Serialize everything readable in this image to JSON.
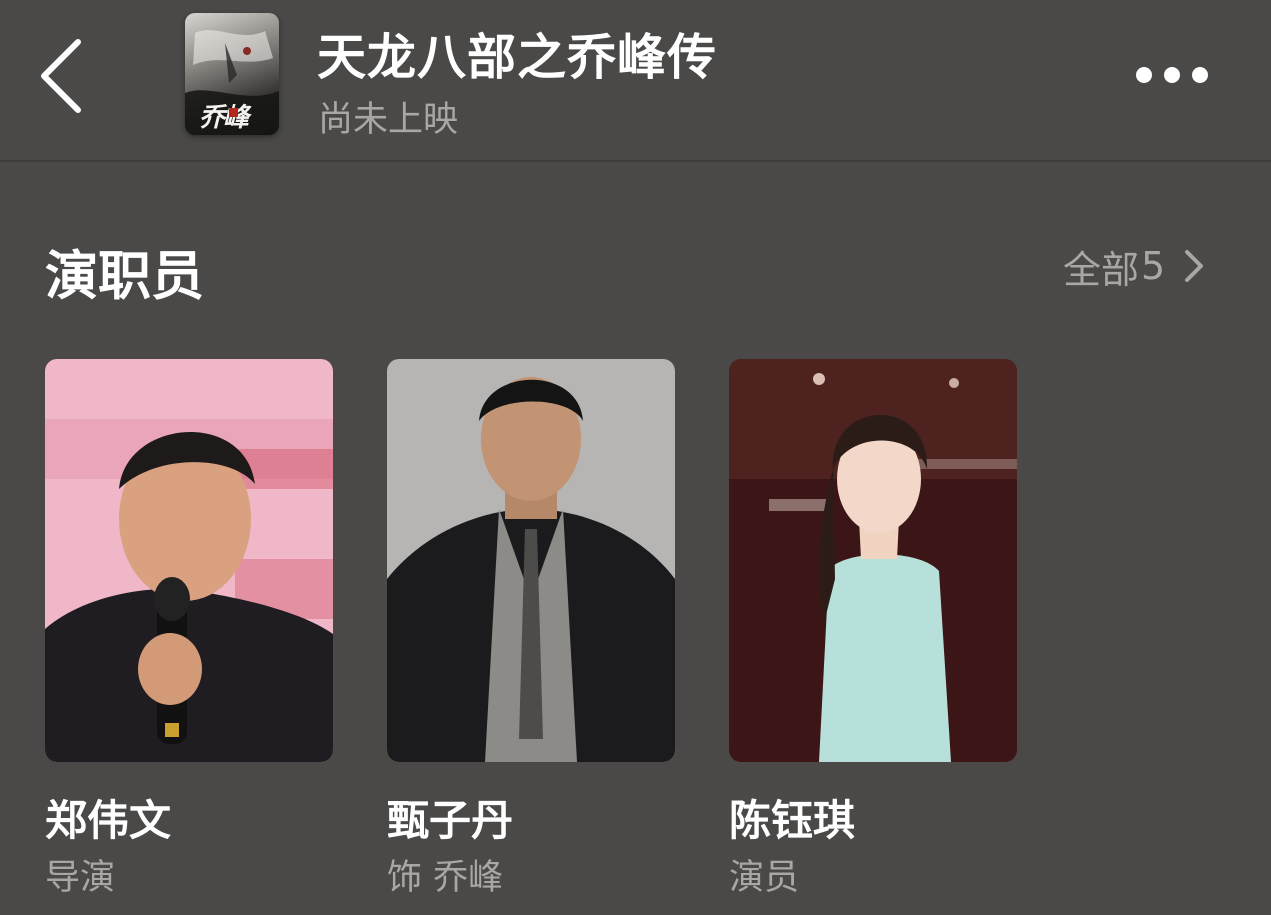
{
  "header": {
    "back_icon": "chevron-left-icon",
    "poster_text": "乔峰",
    "title": "天龙八部之乔峰传",
    "status": "尚未上映",
    "more_icon": "more-horizontal-icon"
  },
  "section": {
    "title": "演职员",
    "all_label": "全部",
    "all_count": "5",
    "chevron_icon": "chevron-right-icon"
  },
  "cast": [
    {
      "name": "郑伟文",
      "role": "导演"
    },
    {
      "name": "甄子丹",
      "role": "饰 乔峰"
    },
    {
      "name": "陈钰琪",
      "role": "演员"
    }
  ],
  "colors": {
    "background": "#4a4948",
    "primary_text": "#ffffff",
    "secondary_text": "#a9a7a4"
  }
}
